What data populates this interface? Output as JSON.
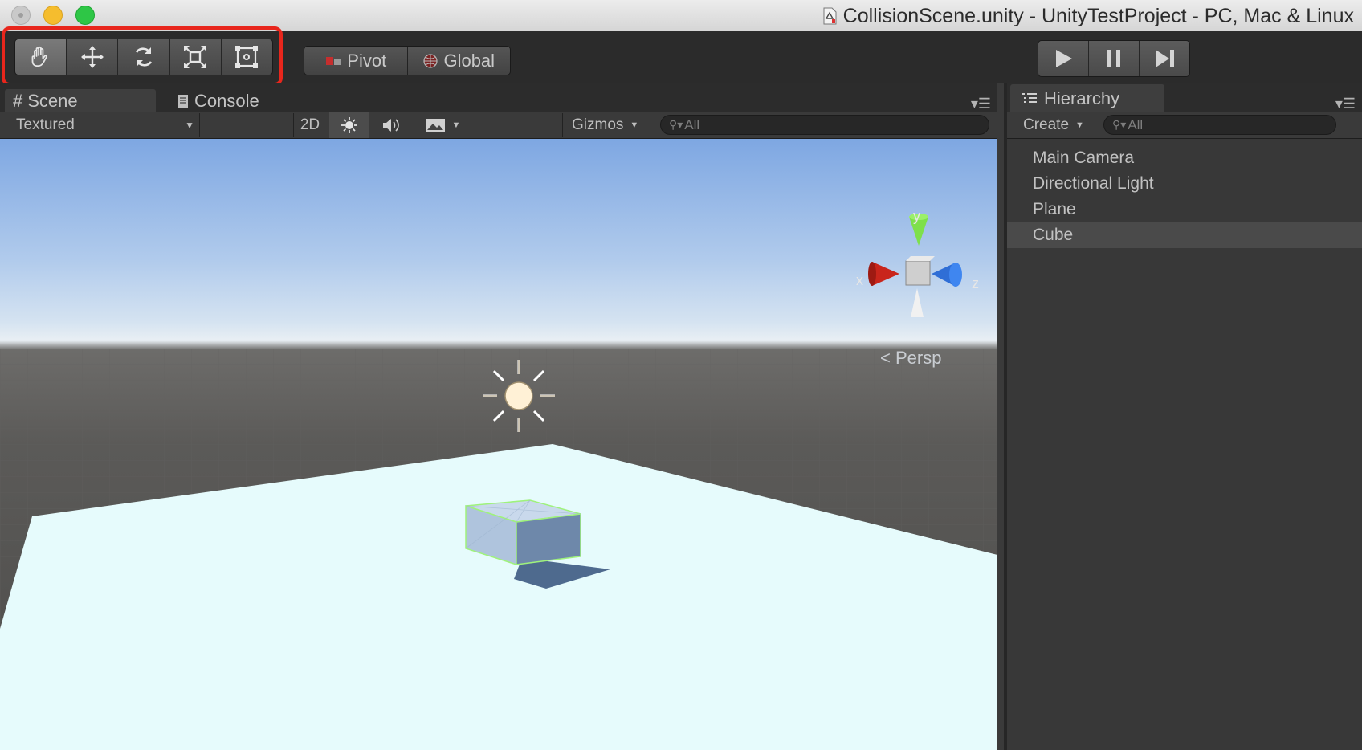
{
  "window": {
    "title": "CollisionScene.unity - UnityTestProject - PC, Mac & Linux"
  },
  "toolbar": {
    "tools": [
      {
        "name": "hand-tool",
        "icon": "hand-icon",
        "active": true
      },
      {
        "name": "move-tool",
        "icon": "move-arrows-icon",
        "active": false
      },
      {
        "name": "rotate-tool",
        "icon": "rotate-icon",
        "active": false
      },
      {
        "name": "scale-tool",
        "icon": "scale-icon",
        "active": false
      },
      {
        "name": "rect-tool",
        "icon": "rect-tool-icon",
        "active": false
      }
    ],
    "pivot_label": "Pivot",
    "global_label": "Global",
    "highlight_color": "#e8261c"
  },
  "scene": {
    "tab_scene": "Scene",
    "tab_console": "Console",
    "shading_mode": "Textured",
    "btn_2d": "2D",
    "gizmos_label": "Gizmos",
    "search_placeholder": "All",
    "persp_label": "Persp",
    "axis_labels": {
      "x": "x",
      "y": "y",
      "z": "z"
    }
  },
  "hierarchy": {
    "tab_label": "Hierarchy",
    "create_label": "Create",
    "search_placeholder": "All",
    "items": [
      "Main Camera",
      "Directional Light",
      "Plane",
      "Cube"
    ],
    "selected_index": 3
  }
}
